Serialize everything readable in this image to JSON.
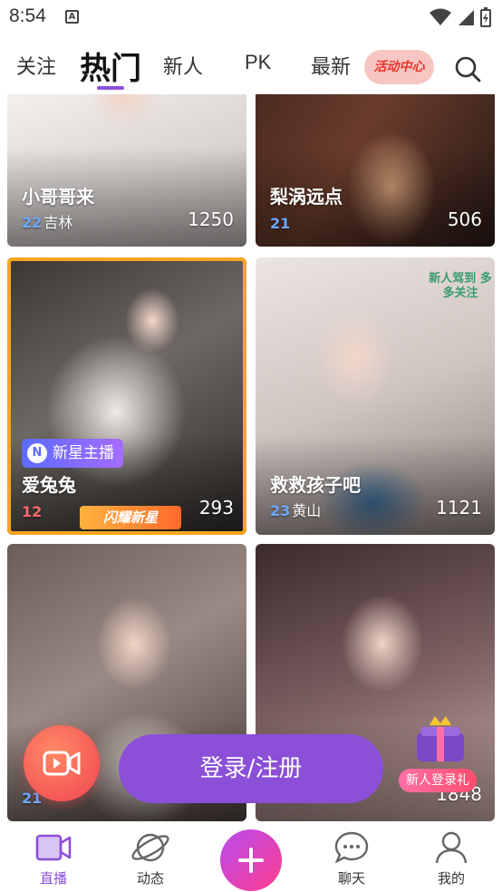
{
  "status_bar": {
    "time": "8:54",
    "notification_glyph": "A"
  },
  "tabs": [
    {
      "label": "关注"
    },
    {
      "label": "热门"
    },
    {
      "label": "新人"
    },
    {
      "label": "PK"
    },
    {
      "label": "最新"
    }
  ],
  "event_badge": "活动中心",
  "cards": [
    {
      "title": "小哥哥来",
      "age": "22",
      "location": "吉林",
      "count": "1250"
    },
    {
      "title": "梨涡远点",
      "age": "21",
      "location": "",
      "count": "506"
    },
    {
      "title": "爱兔兔",
      "age": "12",
      "location": "",
      "count": "293",
      "tag": "新星主播",
      "tag_letter": "N",
      "shine": "闪耀新星"
    },
    {
      "title": "救救孩子吧",
      "age": "23",
      "location": "黄山",
      "count": "1121",
      "sticker": "新人驾到 多多关注"
    },
    {
      "title": "",
      "age": "21",
      "location": "",
      "count": ""
    },
    {
      "title": "",
      "age": "",
      "location": "",
      "count": "1848",
      "gift": "新人登录礼"
    }
  ],
  "login_button": "登录/注册",
  "bottom_nav": [
    {
      "label": "直播",
      "icon": "video-icon"
    },
    {
      "label": "动态",
      "icon": "planet-icon"
    },
    {
      "label": "聊天",
      "icon": "chat-bubble-icon"
    },
    {
      "label": "我的",
      "icon": "person-icon"
    }
  ],
  "colors": {
    "accent": "#8b4fd8",
    "event_text": "#e6332a",
    "gold": "#f7a51f"
  }
}
